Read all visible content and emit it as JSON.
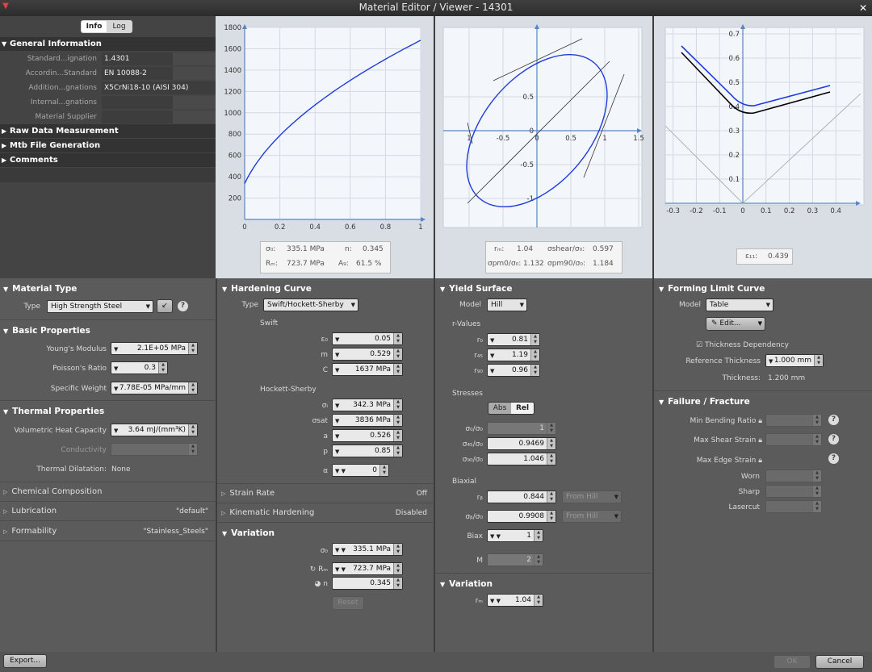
{
  "window": {
    "title": "Material Editor / Viewer - 14301",
    "close": "✕",
    "logo": "▼"
  },
  "tabs": [
    {
      "label": "Info"
    },
    {
      "label": "Log"
    }
  ],
  "general": {
    "title": "General Information",
    "rows": [
      {
        "label": "Standard...ignation",
        "value": "1.4301"
      },
      {
        "label": "Accordin...Standard",
        "value": "EN 10088-2"
      },
      {
        "label": "Addition...gnations",
        "value": "X5CrNi18-10 (AISI 304)"
      },
      {
        "label": "Internal...gnations",
        "value": ""
      },
      {
        "label": "Material Supplier",
        "value": ""
      }
    ]
  },
  "collapsed_sections": [
    {
      "title": "Raw Data Measurement"
    },
    {
      "title": "Mtb File Generation"
    },
    {
      "title": "Comments"
    }
  ],
  "plot1": {
    "xticks": [
      "0",
      "0.2",
      "0.4",
      "0.6",
      "0.8",
      "1"
    ],
    "yticks": [
      "200",
      "400",
      "600",
      "800",
      "1000",
      "1200",
      "1400",
      "1600",
      "1800"
    ],
    "readout": {
      "s0_label": "σ₀:",
      "s0": "335.1 MPa",
      "n_label": "n:",
      "n": "0.345",
      "rm_label": "Rₘ:",
      "rm": "723.7 MPa",
      "ag_label": "A₉:",
      "ag": "61.5 %"
    }
  },
  "plot2": {
    "xticks": [
      "1",
      "-0.5",
      "0",
      "0.5",
      "1",
      "1.5"
    ],
    "yticks": [
      "0.5",
      "0",
      "-0.5",
      "-1"
    ],
    "readout": {
      "rm_label": "rₘ:",
      "rm": "1.04",
      "shear_label": "σshear/σ₀:",
      "shear": "0.597",
      "pm0_label": "σpm0/σ₀:",
      "pm0": "1.132",
      "pm90_label": "σpm90/σ₀:",
      "pm90": "1.184"
    }
  },
  "plot3": {
    "xticks": [
      "-0.3",
      "-0.2",
      "-0.1",
      "0",
      "0.1",
      "0.2",
      "0.3",
      "0.4"
    ],
    "yticks": [
      "0.7",
      "0.6",
      "0.5",
      "0.4",
      "0.3",
      "0.2",
      "0.1"
    ],
    "readout": {
      "e11_label": "ε₁₁:",
      "e11": "0.439"
    }
  },
  "material_type": {
    "title": "Material Type",
    "type_label": "Type",
    "type_value": "High Strength Steel",
    "help": "?"
  },
  "basic": {
    "title": "Basic Properties",
    "youngs_label": "Young's Modulus",
    "youngs": "2.1E+05 MPa",
    "poisson_label": "Poisson's Ratio",
    "poisson": "0.3",
    "weight_label": "Specific Weight",
    "weight": "7.78E-05 MPa/mm"
  },
  "thermal": {
    "title": "Thermal Properties",
    "heat_label": "Volumetric Heat Capacity",
    "heat": "3.64 mJ/(mm³K)",
    "cond_label": "Conductivity",
    "dil_label": "Thermal Dilatation:",
    "dil": "None"
  },
  "left_collapsed": [
    {
      "title": "Chemical Composition",
      "value": ""
    },
    {
      "title": "Lubrication",
      "value": "\"default\""
    },
    {
      "title": "Formability",
      "value": "\"Stainless_Steels\""
    }
  ],
  "hardening": {
    "title": "Hardening Curve",
    "type_label": "Type",
    "type_value": "Swift/Hockett-Sherby",
    "swift_label": "Swift",
    "swift": [
      {
        "label": "ε₀",
        "value": "0.05"
      },
      {
        "label": "m",
        "value": "0.529"
      },
      {
        "label": "C",
        "value": "1637 MPa"
      }
    ],
    "hs_label": "Hockett-Sherby",
    "hs": [
      {
        "label": "σᵢ",
        "value": "342.3 MPa"
      },
      {
        "label": "σsat",
        "value": "3836 MPa"
      },
      {
        "label": "a",
        "value": "0.526"
      },
      {
        "label": "p",
        "value": "0.85"
      }
    ],
    "alpha_label": "α",
    "alpha": "0"
  },
  "strain_rate": {
    "title": "Strain Rate",
    "value": "Off"
  },
  "kinematic": {
    "title": "Kinematic Hardening",
    "value": "Disabled"
  },
  "variation_h": {
    "title": "Variation",
    "s0_label": "σ₀",
    "s0": "335.1 MPa",
    "rm_label": "Rₘ",
    "rm": "723.7 MPa",
    "n_label": "n",
    "n": "0.345",
    "reset": "Reset"
  },
  "yield": {
    "title": "Yield Surface",
    "model_label": "Model",
    "model": "Hill",
    "rvalues_label": "r-Values",
    "r": [
      {
        "label": "r₀",
        "value": "0.81"
      },
      {
        "label": "r₄₅",
        "value": "1.19"
      },
      {
        "label": "r₉₀",
        "value": "0.96"
      }
    ],
    "stresses_label": "Stresses",
    "abs": "Abs",
    "rel": "Rel",
    "s": [
      {
        "label": "σ₀/σ₀",
        "value": "1"
      },
      {
        "label": "σ₄₅/σ₀",
        "value": "0.9469"
      },
      {
        "label": "σ₉₀/σ₀",
        "value": "1.046"
      }
    ],
    "biaxial_label": "Biaxial",
    "rb_label": "rᵦ",
    "rb": "0.844",
    "rb_from": "From Hill",
    "sb_label": "σᵦ/σ₀",
    "sb": "0.9908",
    "sb_from": "From Hill",
    "biax_label": "Biax",
    "biax": "1",
    "m_label": "M",
    "m": "2"
  },
  "variation_y": {
    "title": "Variation",
    "rm_label": "rₘ",
    "rm": "1.04"
  },
  "flc": {
    "title": "Forming Limit Curve",
    "model_label": "Model",
    "model": "Table",
    "edit": "Edit...",
    "thick_dep": "Thickness Dependency",
    "ref_label": "Reference Thickness",
    "ref": "1.000 mm",
    "thick_label": "Thickness:",
    "thick": "1.200 mm"
  },
  "failure": {
    "title": "Failure / Fracture",
    "bend_label": "Min Bending Ratio",
    "shear_label": "Max Shear Strain",
    "edge_label": "Max Edge Strain",
    "worn_label": "Worn",
    "sharp_label": "Sharp",
    "laser_label": "Lasercut"
  },
  "footer": {
    "export": "Export...",
    "ok": "OK",
    "cancel": "Cancel"
  },
  "colors": {
    "curve_blue": "#1f3cdb",
    "curve_black": "#000000",
    "grid": "#c9d2de",
    "axis": "#5a84c8"
  }
}
